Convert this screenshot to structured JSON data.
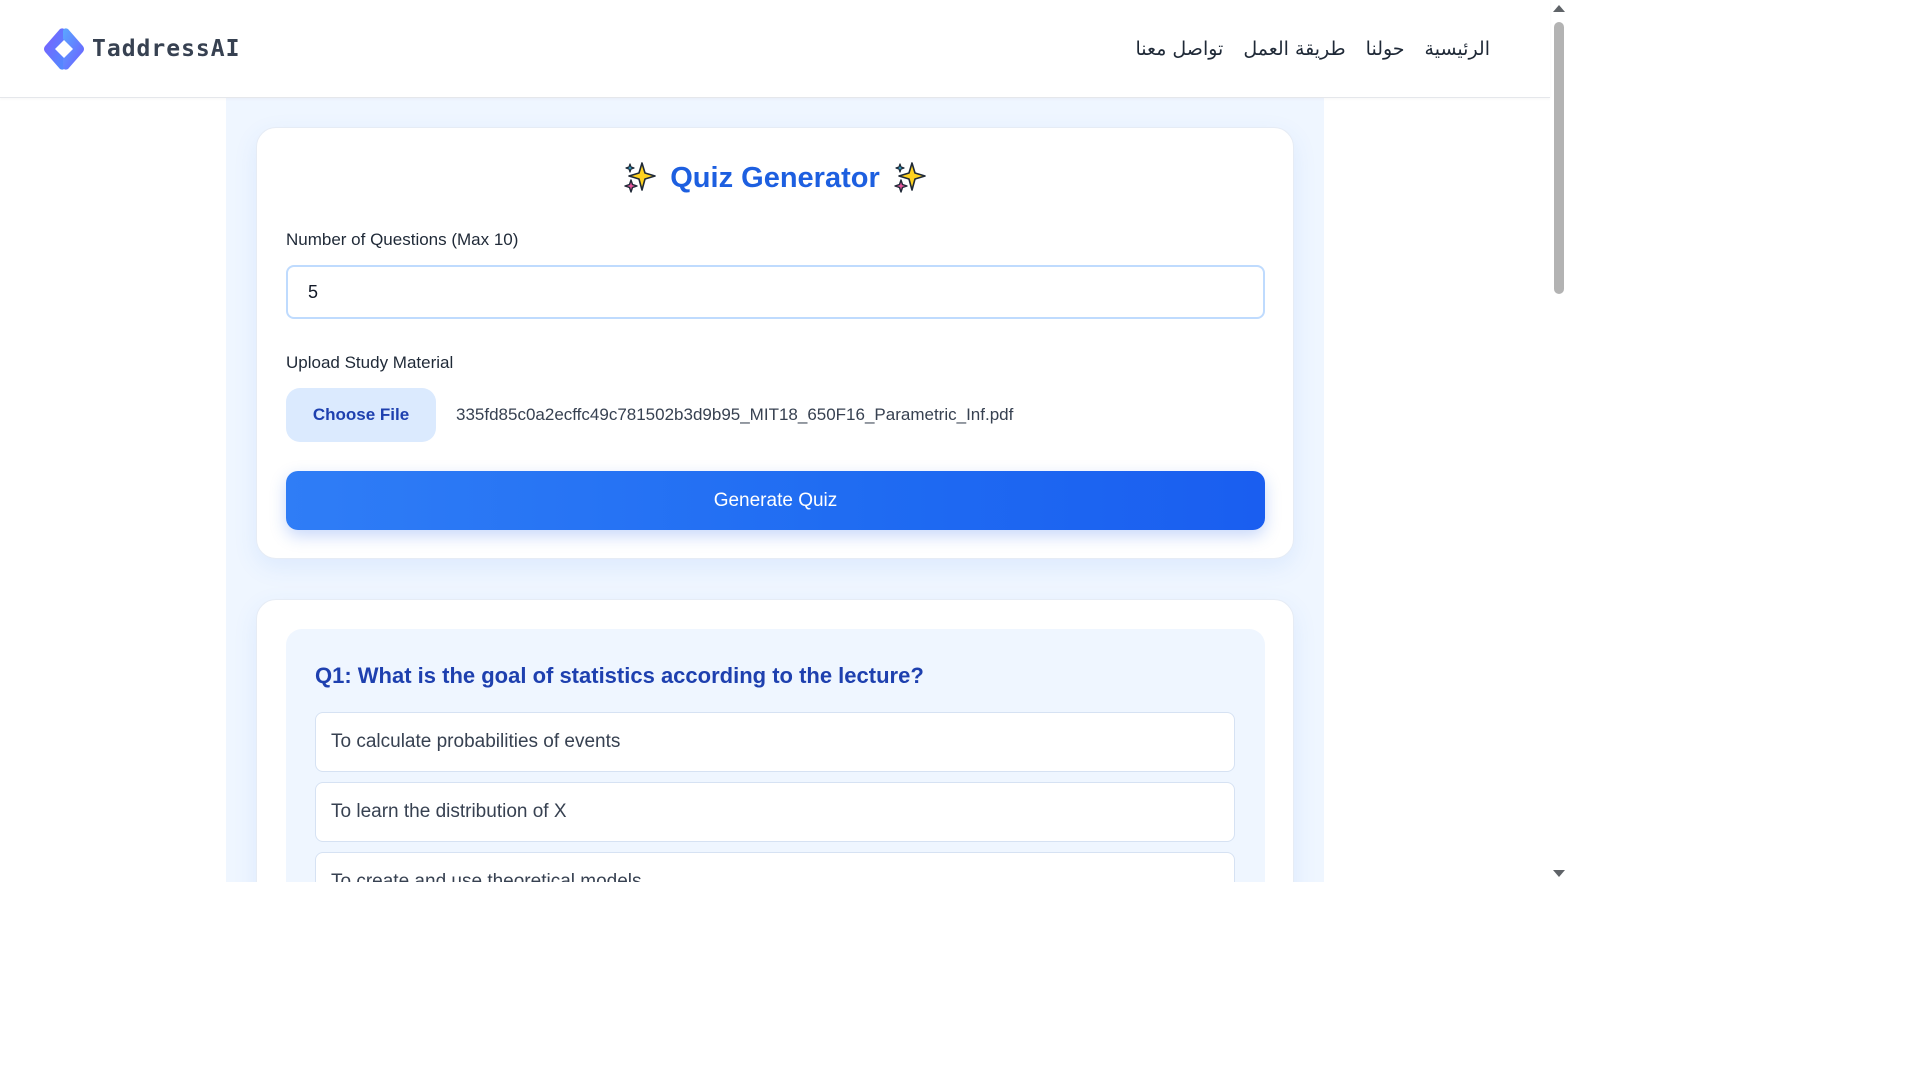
{
  "brand": {
    "name": "TaddressAI",
    "logo_icon": "chevron-logo-icon",
    "colors": [
      "#6d5bff",
      "#4aa3ff"
    ]
  },
  "nav": {
    "items": [
      {
        "label": "الرئيسية"
      },
      {
        "label": "حولنا"
      },
      {
        "label": "طريقة العمل"
      },
      {
        "label": "تواصل معنا"
      }
    ]
  },
  "form": {
    "title": "Quiz Generator",
    "title_icon": "sparkles-icon",
    "questions_label": "Number of Questions (Max 10)",
    "questions_value": "5",
    "upload_label": "Upload Study Material",
    "choose_file_label": "Choose File",
    "file_name": "335fd85c0a2ecffc49c781502b3d9b95_MIT18_650F16_Parametric_Inf.pdf",
    "generate_label": "Generate Quiz"
  },
  "quiz": {
    "question": "Q1: What is the goal of statistics according to the lecture?",
    "options": [
      "To calculate probabilities of events",
      "To learn the distribution of X",
      "To create and use theoretical models"
    ]
  },
  "colors": {
    "accent": "#1d5fe0",
    "page_bg": "#eff6ff",
    "button": "#2673f4"
  }
}
